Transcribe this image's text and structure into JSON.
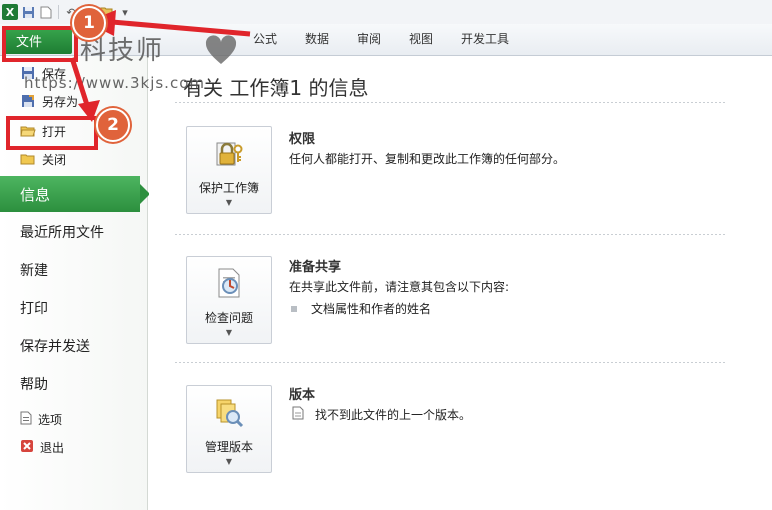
{
  "quick_access": {
    "app_icon": "X",
    "icons": [
      "excel-icon",
      "save-icon",
      "new-icon",
      "undo-icon",
      "redo-icon",
      "open-folder-icon",
      "customize-icon"
    ]
  },
  "ribbon": {
    "file_tab": "文件",
    "tabs": [
      "公式",
      "数据",
      "审阅",
      "视图",
      "开发工具"
    ]
  },
  "backstage_nav": {
    "save": "保存",
    "save_as": "另存为",
    "open": "打开",
    "close": "关闭",
    "info": "信息",
    "recent": "最近所用文件",
    "new": "新建",
    "print": "打印",
    "save_send": "保存并发送",
    "help": "帮助",
    "options": "选项",
    "exit": "退出"
  },
  "info_pane": {
    "title": "有关 工作簿1 的信息",
    "permissions": {
      "button_label": "保护工作簿",
      "heading": "权限",
      "description": "任何人都能打开、复制和更改此工作簿的任何部分。"
    },
    "prepare": {
      "button_label": "检查问题",
      "heading": "准备共享",
      "description": "在共享此文件前，请注意其包含以下内容:",
      "bullets": [
        "文档属性和作者的姓名"
      ]
    },
    "versions": {
      "button_label": "管理版本",
      "heading": "版本",
      "description": "找不到此文件的上一个版本。"
    }
  },
  "overlay": {
    "watermark_main": "科技师",
    "watermark_url": "https://www.3kjs.com",
    "badge_1": "1",
    "badge_2": "2",
    "accent_color": "#e0252b"
  }
}
